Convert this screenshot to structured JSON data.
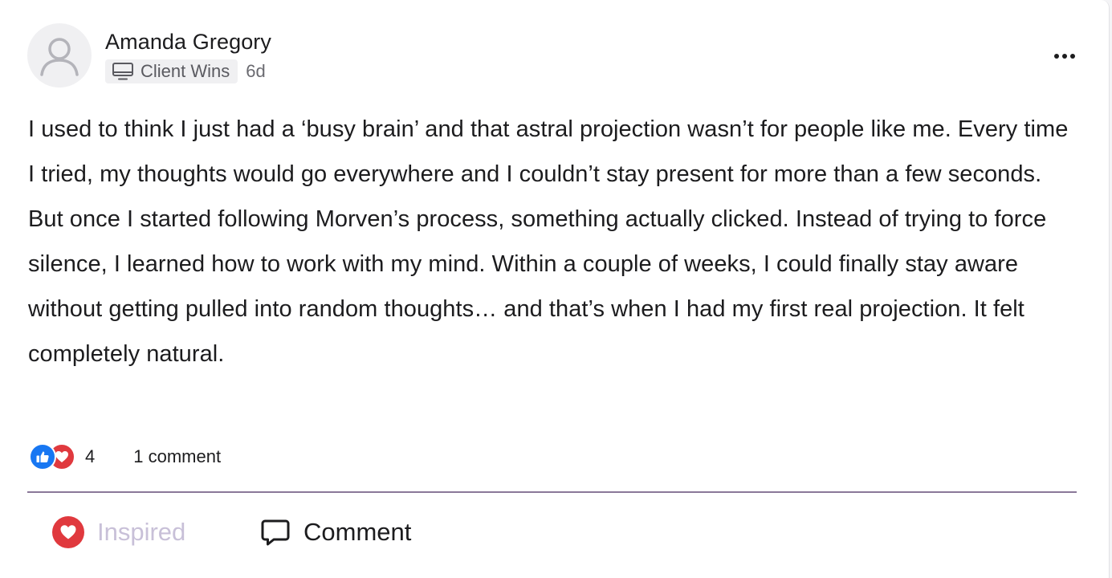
{
  "post": {
    "author": "Amanda Gregory",
    "category": "Client Wins",
    "time": "6d",
    "body": "I used to think I just had a ‘busy brain’ and that astral projection wasn’t for people like me. Every time I tried, my thoughts would go everywhere and I couldn’t stay present for more than a few seconds. But once I started following Morven’s process, something actually clicked. Instead of trying to force silence, I learned how to work with my mind. Within a couple of weeks, I could finally stay aware without getting pulled into random thoughts… and that’s when I had my first real projection. It felt completely natural."
  },
  "stats": {
    "reaction_count": "4",
    "comments": "1 comment"
  },
  "actions": {
    "inspired_label": "Inspired",
    "comment_label": "Comment"
  },
  "icons": {
    "avatar": "user-placeholder-icon",
    "category": "monitor-icon",
    "more": "more-options-icon",
    "reaction_like": "thumbs-up-icon",
    "reaction_love": "heart-icon",
    "inspired": "heart-icon",
    "comment": "speech-bubble-icon"
  },
  "colors": {
    "like_blue": "#1877f2",
    "heart_red": "#e0393e",
    "inspired_text": "#c8c0d8",
    "divider": "#8a7898"
  }
}
